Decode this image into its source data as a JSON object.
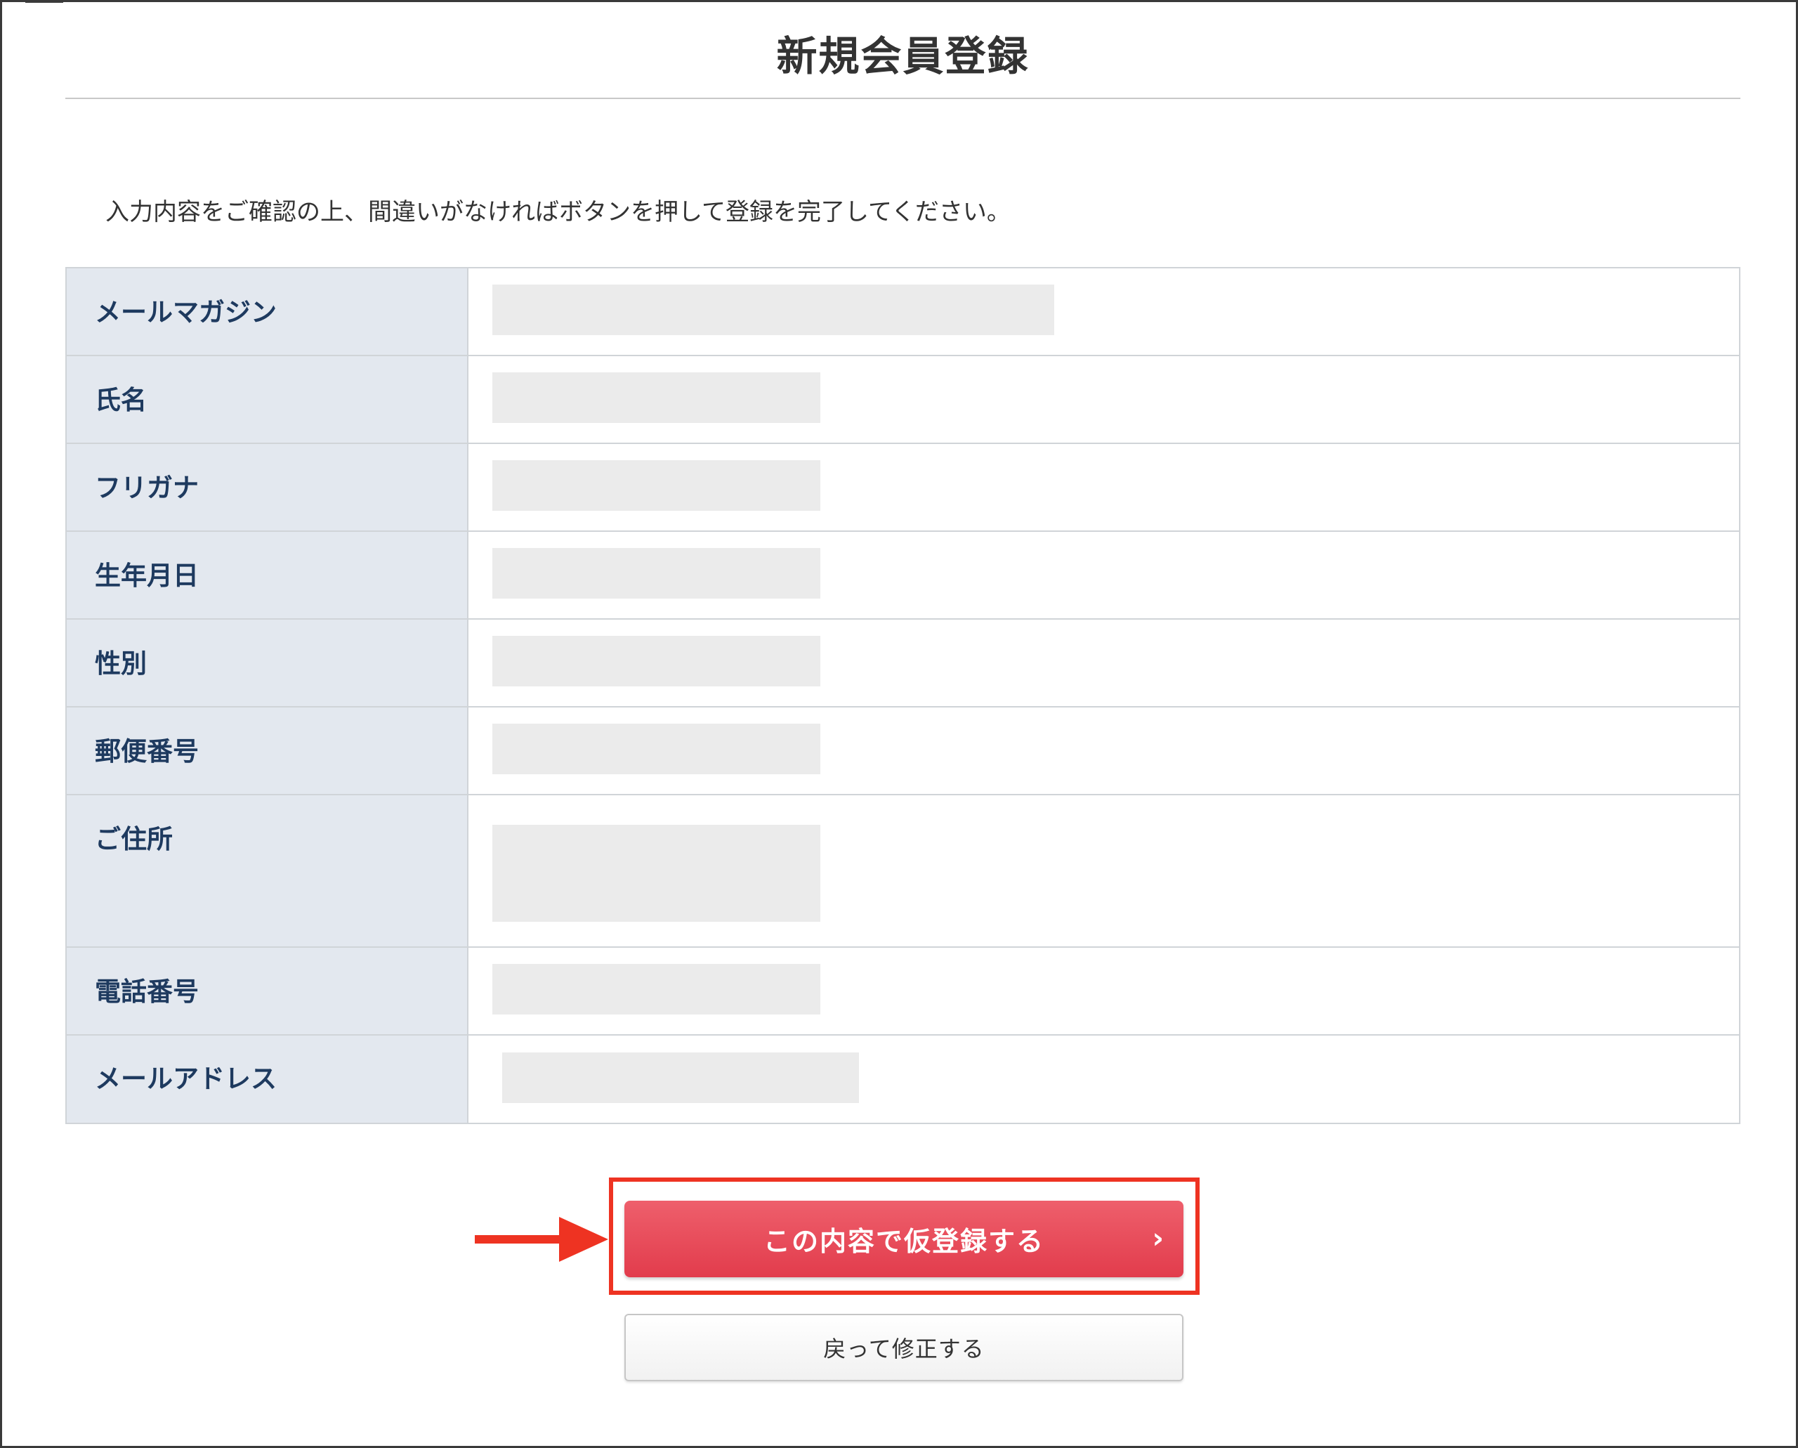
{
  "page": {
    "title": "新規会員登録",
    "intro": "入力内容をご確認の上、間違いがなければボタンを押して登録を完了してください。"
  },
  "table": {
    "rows": [
      {
        "label": "メールマガジン"
      },
      {
        "label": "氏名"
      },
      {
        "label": "フリガナ"
      },
      {
        "label": "生年月日"
      },
      {
        "label": "性別"
      },
      {
        "label": "郵便番号"
      },
      {
        "label": "ご住所"
      },
      {
        "label": "電話番号"
      },
      {
        "label": "メールアドレス"
      }
    ]
  },
  "buttons": {
    "submit_label": "この内容で仮登録する",
    "submit_chevron": "›",
    "back_label": "戻って修正する"
  },
  "colors": {
    "highlight": "#ee3322",
    "submit": "#e23c4c",
    "label_bg": "#e3e8ef",
    "label_text": "#1e3a5f"
  },
  "icons": {
    "annotation": "right-arrow-icon",
    "submit": "chevron-right-icon"
  }
}
